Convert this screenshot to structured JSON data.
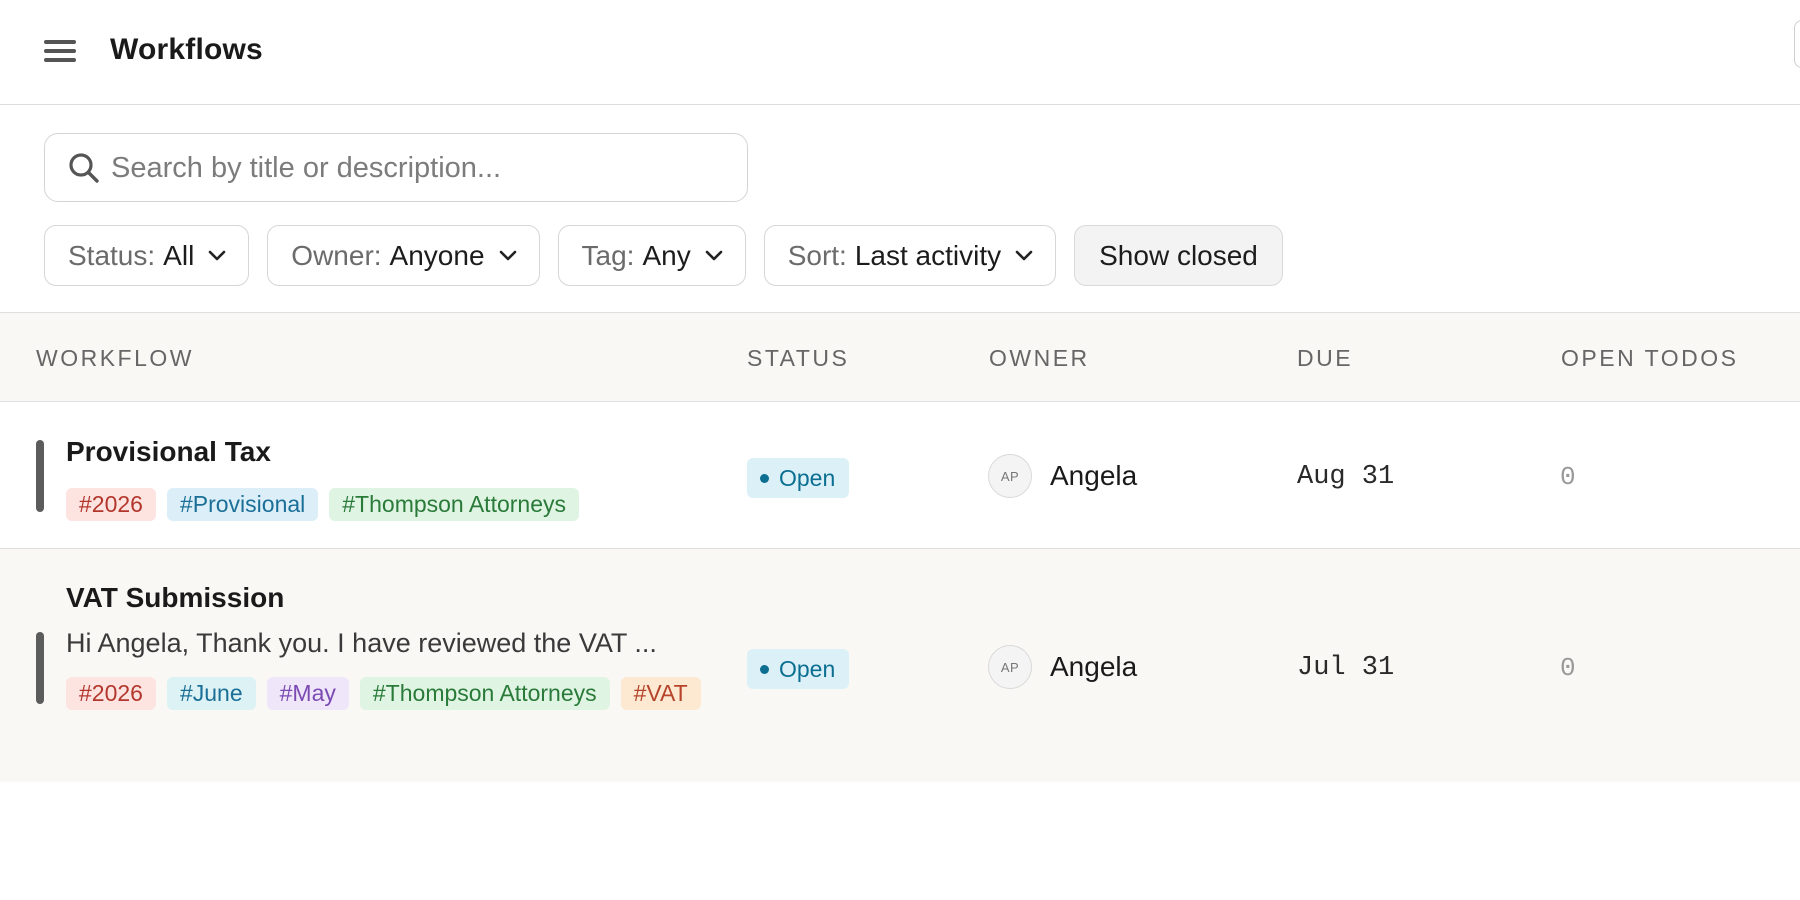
{
  "header": {
    "title": "Workflows",
    "menu_icon": "hamburger-menu-icon"
  },
  "search": {
    "placeholder": "Search by title or description...",
    "value": "",
    "icon": "search-icon"
  },
  "filters": [
    {
      "label": "Status:",
      "value": "All"
    },
    {
      "label": "Owner:",
      "value": "Anyone"
    },
    {
      "label": "Tag:",
      "value": "Any"
    },
    {
      "label": "Sort:",
      "value": "Last activity"
    }
  ],
  "toggle": {
    "label": "Show closed"
  },
  "table": {
    "columns": [
      "WORKFLOW",
      "STATUS",
      "OWNER",
      "DUE",
      "OPEN TODOS"
    ],
    "rows": [
      {
        "title": "Provisional Tax",
        "description": "",
        "tags": [
          {
            "label": "#2026",
            "bg": "#fde4e1",
            "fg": "#b3372c"
          },
          {
            "label": "#Provisional",
            "bg": "#dceff9",
            "fg": "#1b6f97"
          },
          {
            "label": "#Thompson Attorneys",
            "bg": "#dff4e2",
            "fg": "#2a7a3a"
          }
        ],
        "status": "Open",
        "owner": {
          "initials": "AP",
          "name": "Angela"
        },
        "due": "Aug 31",
        "open_todos": "0"
      },
      {
        "title": "VAT Submission",
        "description": "Hi Angela, Thank you. I have reviewed the VAT ...",
        "tags": [
          {
            "label": "#2026",
            "bg": "#fde4e1",
            "fg": "#b3372c"
          },
          {
            "label": "#June",
            "bg": "#dcf2f5",
            "fg": "#1b6f97"
          },
          {
            "label": "#May",
            "bg": "#efe6fa",
            "fg": "#7a4ab2"
          },
          {
            "label": "#Thompson Attorneys",
            "bg": "#dff4e2",
            "fg": "#2a7a3a"
          },
          {
            "label": "#VAT",
            "bg": "#fde8d2",
            "fg": "#b5442a"
          }
        ],
        "status": "Open",
        "owner": {
          "initials": "AP",
          "name": "Angela"
        },
        "due": "Jul 31",
        "open_todos": "0"
      }
    ]
  },
  "colors": {
    "status_open_bg": "#dcf0f8",
    "status_open_fg": "#0c6f91",
    "row_alt_bg": "#faf8f5",
    "row_bar": "#5c5c5c"
  }
}
